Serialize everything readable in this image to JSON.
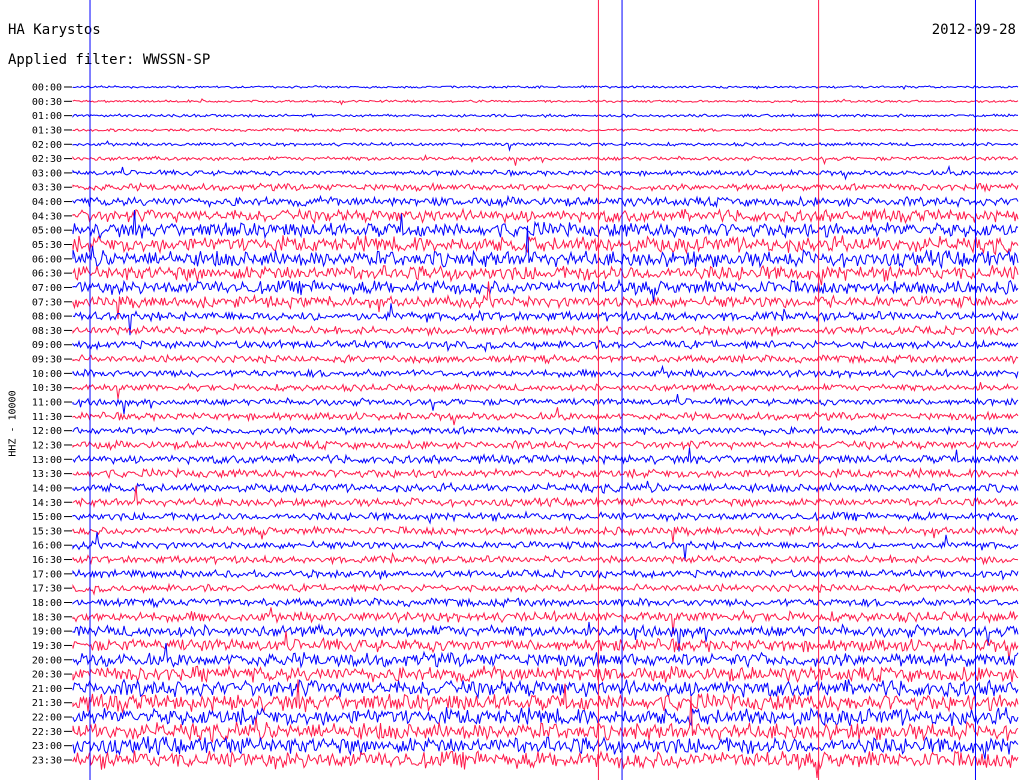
{
  "header": {
    "station": "HA Karystos",
    "date": "2012-09-28",
    "filter": "Applied filter: WWSSN-SP"
  },
  "chart_data": {
    "type": "line",
    "title": "",
    "ylabel": "HHZ - 10000",
    "row_labels": [
      "00:00",
      "00:30",
      "01:00",
      "01:30",
      "02:00",
      "02:30",
      "03:00",
      "03:30",
      "04:00",
      "04:30",
      "05:00",
      "05:30",
      "06:00",
      "06:30",
      "07:00",
      "07:30",
      "08:00",
      "08:30",
      "09:00",
      "09:30",
      "10:00",
      "10:30",
      "11:00",
      "11:30",
      "12:00",
      "12:30",
      "13:00",
      "13:30",
      "14:00",
      "14:30",
      "15:00",
      "15:30",
      "16:00",
      "16:30",
      "17:00",
      "17:30",
      "18:00",
      "18:30",
      "19:00",
      "19:30",
      "20:00",
      "20:30",
      "21:00",
      "21:30",
      "22:00",
      "22:30",
      "23:00",
      "23:30"
    ],
    "series_colors": [
      "#0000ff",
      "#ff1a4a"
    ],
    "noise_level": [
      0.4,
      0.4,
      0.5,
      0.5,
      0.6,
      0.7,
      0.9,
      1.2,
      1.6,
      2.2,
      2.6,
      2.8,
      2.8,
      2.6,
      2.4,
      2.0,
      1.6,
      1.4,
      1.4,
      1.3,
      1.3,
      1.2,
      1.2,
      1.3,
      1.3,
      1.4,
      1.5,
      1.5,
      1.5,
      1.4,
      1.4,
      1.4,
      1.3,
      1.3,
      1.3,
      1.3,
      1.4,
      1.8,
      2.0,
      2.2,
      2.4,
      2.6,
      2.9,
      3.0,
      3.0,
      3.0,
      3.0,
      3.0
    ],
    "events_fraction": [
      0.018,
      0.556,
      0.581,
      0.789,
      0.955
    ]
  }
}
